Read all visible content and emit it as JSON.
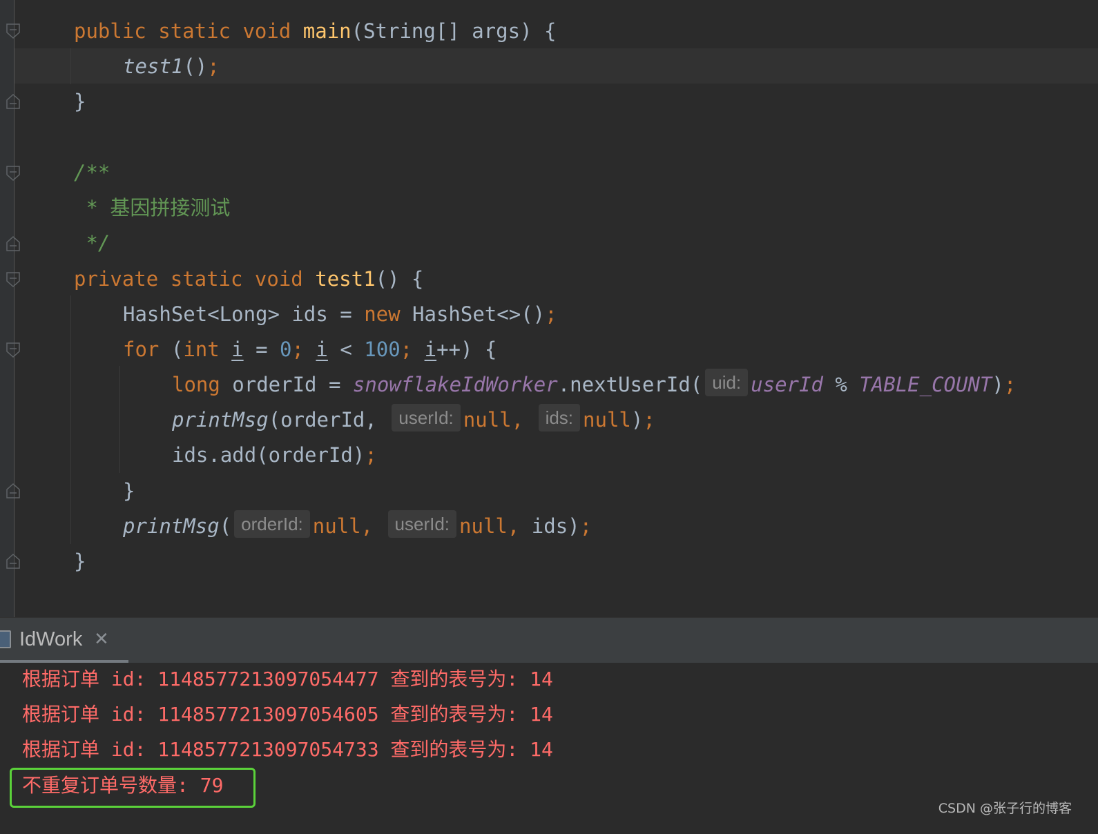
{
  "editor": {
    "main_sig": {
      "mod1": "public",
      "mod2": "static",
      "ret": "void",
      "name": "main",
      "params": "(String[] args) {"
    },
    "main_call": {
      "name": "test1",
      "rest": "()",
      "semi": ";"
    },
    "close1": "}",
    "javadoc": {
      "open": "/**",
      "star": " * ",
      "text": "基因拼接测试",
      "close": " */"
    },
    "test1_sig": {
      "mod1": "private",
      "mod2": "static",
      "ret": "void",
      "name": "test1",
      "params": "() {"
    },
    "hashset_line": {
      "type": "HashSet<Long> ids = ",
      "kw_new": "new",
      "rest": " HashSet<>()",
      "semi": ";"
    },
    "for_line": {
      "kw_for": "for",
      "paren": " (",
      "kw_int": "int",
      "sp1": " ",
      "var1": "i",
      "eq": " = ",
      "zero": "0",
      "semi1": "; ",
      "var2": "i",
      "lt": " < ",
      "hundred": "100",
      "semi2": "; ",
      "var3": "i",
      "rest": "++) {"
    },
    "orderid_line": {
      "kw_long": "long",
      "mid": " orderId = ",
      "worker": "snowflakeIdWorker",
      "call": ".nextUserId(",
      "hint": "uid:",
      "userid": "userId",
      "mod": " % ",
      "const": "TABLE_COUNT",
      "end": ")",
      "semi": ";"
    },
    "printmsg1": {
      "name": "printMsg",
      "open": "(orderId, ",
      "hint1": "userId:",
      "null1": "null",
      "comma": ", ",
      "hint2": "ids:",
      "null2": "null",
      "end": ")",
      "semi": ";"
    },
    "add_line": {
      "text": "ids.add(orderId)",
      "semi": ";"
    },
    "close_for": "}",
    "printmsg2": {
      "name": "printMsg",
      "open": "(",
      "hint1": "orderId:",
      "null1": "null",
      "comma1": ", ",
      "hint2": "userId:",
      "null2": "null",
      "comma2": ", ",
      "rest": "ids)",
      "semi": ";"
    },
    "close2": "}"
  },
  "run_panel": {
    "tab_label": "IdWork",
    "close_glyph": "✕",
    "output": [
      "根据订单 id: 1148577213097054477 查到的表号为: 14",
      "根据订单 id: 1148577213097054605 查到的表号为: 14",
      "根据订单 id: 1148577213097054733 查到的表号为: 14",
      "不重复订单号数量: 79"
    ]
  },
  "watermark": "CSDN @张子行的博客",
  "colors": {
    "background": "#2b2b2b",
    "keyword": "#cc7832",
    "function": "#ffc66d",
    "comment": "#629755",
    "number": "#6897bb",
    "field": "#9876aa",
    "console_error": "#ff6b68",
    "highlight_box": "#5bd23a"
  }
}
